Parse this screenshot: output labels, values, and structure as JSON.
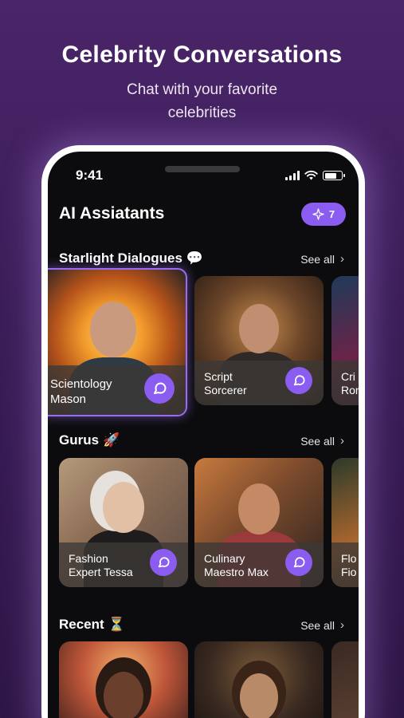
{
  "promo": {
    "title": "Celebrity Conversations",
    "subtitle_line1": "Chat with your favorite",
    "subtitle_line2": "celebrities"
  },
  "status_bar": {
    "time": "9:41"
  },
  "header": {
    "title": "AI Assiatants",
    "credits": "7"
  },
  "sections": {
    "starlight": {
      "title": "Starlight Dialogues",
      "emoji": "💬",
      "see_all": "See all",
      "cards": [
        {
          "line1": "Scientology",
          "line2": "Mason"
        },
        {
          "line1": "Script",
          "line2": "Sorcerer"
        },
        {
          "line1": "Cri",
          "line2": "Ron"
        }
      ]
    },
    "gurus": {
      "title": "Gurus",
      "emoji": "🚀",
      "see_all": "See all",
      "cards": [
        {
          "line1": "Fashion",
          "line2": "Expert Tessa"
        },
        {
          "line1": "Culinary",
          "line2": "Maestro Max"
        },
        {
          "line1": "Flo",
          "line2": "Fio"
        }
      ]
    },
    "recent": {
      "title": "Recent",
      "emoji": "⏳",
      "see_all": "See all"
    }
  },
  "colors": {
    "accent": "#8a5cf0",
    "background": "#4a2569",
    "screen": "#0c0c0e"
  },
  "icons": [
    "signal-icon",
    "wifi-icon",
    "battery-icon",
    "sparkle-icon",
    "chevron-right-icon",
    "chat-icon"
  ]
}
